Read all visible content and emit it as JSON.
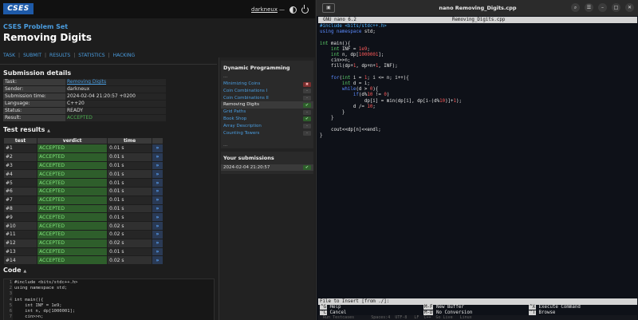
{
  "cses": {
    "logo": "CSES",
    "user": "darkneux",
    "user_suffix": "—",
    "site_title": "CSES Problem Set",
    "page_title": "Removing Digits",
    "tabs": [
      "TASK",
      "SUBMIT",
      "RESULTS",
      "STATISTICS",
      "HACKING"
    ],
    "tab_sep": "|",
    "submission": {
      "heading": "Submission details",
      "rows": [
        {
          "k": "Task:",
          "v": "Removing Digits"
        },
        {
          "k": "Sender:",
          "v": "darkneux"
        },
        {
          "k": "Submission time:",
          "v": "2024-02-04 21:20:57 +0200"
        },
        {
          "k": "Language:",
          "v": "C++20"
        },
        {
          "k": "Status:",
          "v": "READY"
        },
        {
          "k": "Result:",
          "v": "ACCEPTED"
        }
      ]
    },
    "tests": {
      "heading": "Test results",
      "arrow": "▲",
      "headers": [
        "test",
        "verdict",
        "time"
      ],
      "go": "»",
      "rows": [
        {
          "t": "#1",
          "v": "ACCEPTED",
          "time": "0.01 s"
        },
        {
          "t": "#2",
          "v": "ACCEPTED",
          "time": "0.01 s"
        },
        {
          "t": "#3",
          "v": "ACCEPTED",
          "time": "0.01 s"
        },
        {
          "t": "#4",
          "v": "ACCEPTED",
          "time": "0.01 s"
        },
        {
          "t": "#5",
          "v": "ACCEPTED",
          "time": "0.01 s"
        },
        {
          "t": "#6",
          "v": "ACCEPTED",
          "time": "0.01 s"
        },
        {
          "t": "#7",
          "v": "ACCEPTED",
          "time": "0.01 s"
        },
        {
          "t": "#8",
          "v": "ACCEPTED",
          "time": "0.01 s"
        },
        {
          "t": "#9",
          "v": "ACCEPTED",
          "time": "0.01 s"
        },
        {
          "t": "#10",
          "v": "ACCEPTED",
          "time": "0.02 s"
        },
        {
          "t": "#11",
          "v": "ACCEPTED",
          "time": "0.02 s"
        },
        {
          "t": "#12",
          "v": "ACCEPTED",
          "time": "0.02 s"
        },
        {
          "t": "#13",
          "v": "ACCEPTED",
          "time": "0.01 s"
        },
        {
          "t": "#14",
          "v": "ACCEPTED",
          "time": "0.02 s"
        }
      ]
    },
    "code": {
      "heading": "Code",
      "arrow": "▲",
      "gutter": [
        "1",
        "2",
        "3",
        "4",
        "5",
        "6",
        "7",
        "8"
      ],
      "lines": [
        "#include <bits/stdc++.h>",
        "using namespace std;",
        "",
        "int main(){",
        "    int INF = 1e9;",
        "    int n, dp[1000001];",
        "    cin>>n;",
        "    fill(dp+1, dp+n+1, INF);"
      ]
    },
    "sidebar": {
      "dp_title": "Dynamic Programming",
      "dots": "...",
      "items": [
        {
          "label": "Minimizing Coins",
          "status": "x"
        },
        {
          "label": "Coin Combinations I",
          "status": "none"
        },
        {
          "label": "Coin Combinations II",
          "status": "none"
        },
        {
          "label": "Removing Digits",
          "status": "ok",
          "current": true
        },
        {
          "label": "Grid Paths",
          "status": "none"
        },
        {
          "label": "Book Shop",
          "status": "ok"
        },
        {
          "label": "Array Description",
          "status": "none"
        },
        {
          "label": "Counting Towers",
          "status": "none"
        }
      ],
      "status_glyphs": {
        "x": "✖",
        "ok": "✔",
        "none": "–"
      },
      "your_subs_title": "Your submissions",
      "your_subs": [
        {
          "label": "2024-02-04 21:20:57",
          "status": "ok"
        }
      ]
    }
  },
  "terminal": {
    "newtab_icon": "▣",
    "title": "nano Removing_Digits.cpp",
    "controls": [
      "⌕",
      "☰",
      "–",
      "□",
      "✕"
    ],
    "nano_version": "GNU nano 6.2",
    "nano_file": "Removing_Digits.cpp",
    "prompt": "File to Insert [from ./]:",
    "keys": [
      {
        "k": "^G",
        "l": "Help"
      },
      {
        "k": "^C",
        "l": "Cancel"
      },
      {
        "k": "M-F",
        "l": "New Buffer"
      },
      {
        "k": "M-D",
        "l": "No Conversion"
      },
      {
        "k": "^X",
        "l": "Execute Command"
      },
      {
        "k": "^T",
        "l": "Browse"
      }
    ],
    "status_strip": "  Run Testcases       Spaces:4  UTF-8   LF  C++  Go Live   Linux"
  }
}
